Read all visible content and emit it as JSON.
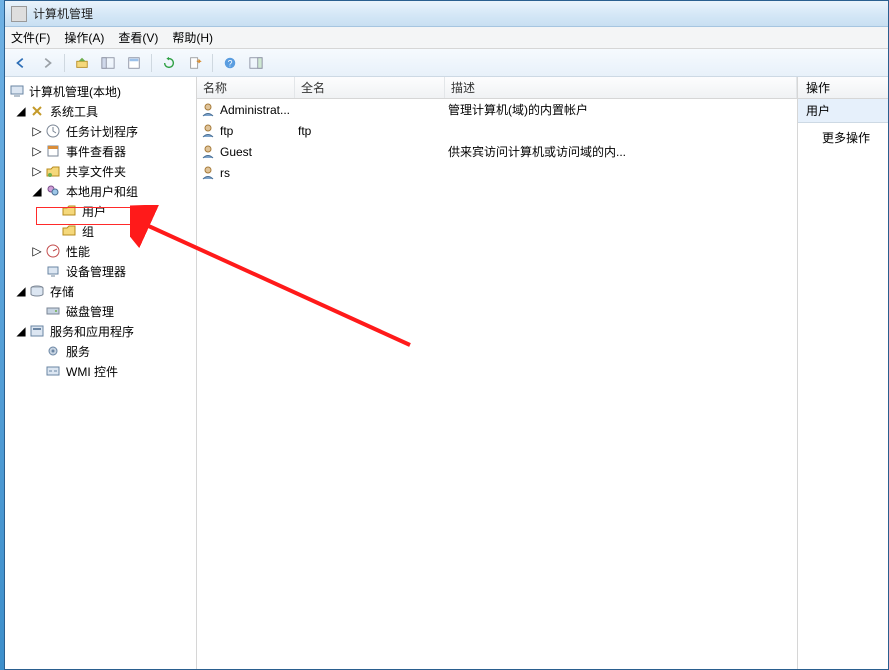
{
  "window": {
    "title": "计算机管理"
  },
  "menu": {
    "file": "文件(F)",
    "action": "操作(A)",
    "view": "查看(V)",
    "help": "帮助(H)"
  },
  "tree": {
    "root": "计算机管理(本地)",
    "system_tools": "系统工具",
    "task_scheduler": "任务计划程序",
    "event_viewer": "事件查看器",
    "shared_folders": "共享文件夹",
    "local_users_groups": "本地用户和组",
    "users": "用户",
    "groups": "组",
    "performance": "性能",
    "device_manager": "设备管理器",
    "storage": "存储",
    "disk_management": "磁盘管理",
    "services_apps": "服务和应用程序",
    "services": "服务",
    "wmi_control": "WMI 控件"
  },
  "columns": {
    "name": "名称",
    "full_name": "全名",
    "description": "描述"
  },
  "users": [
    {
      "name": "Administrat...",
      "full_name": "",
      "description": "管理计算机(域)的内置帐户"
    },
    {
      "name": "ftp",
      "full_name": "ftp",
      "description": ""
    },
    {
      "name": "Guest",
      "full_name": "",
      "description": "供来宾访问计算机或访问域的内..."
    },
    {
      "name": "rs",
      "full_name": "",
      "description": ""
    }
  ],
  "action_pane": {
    "header": "操作",
    "section": "用户",
    "more": "更多操作"
  }
}
